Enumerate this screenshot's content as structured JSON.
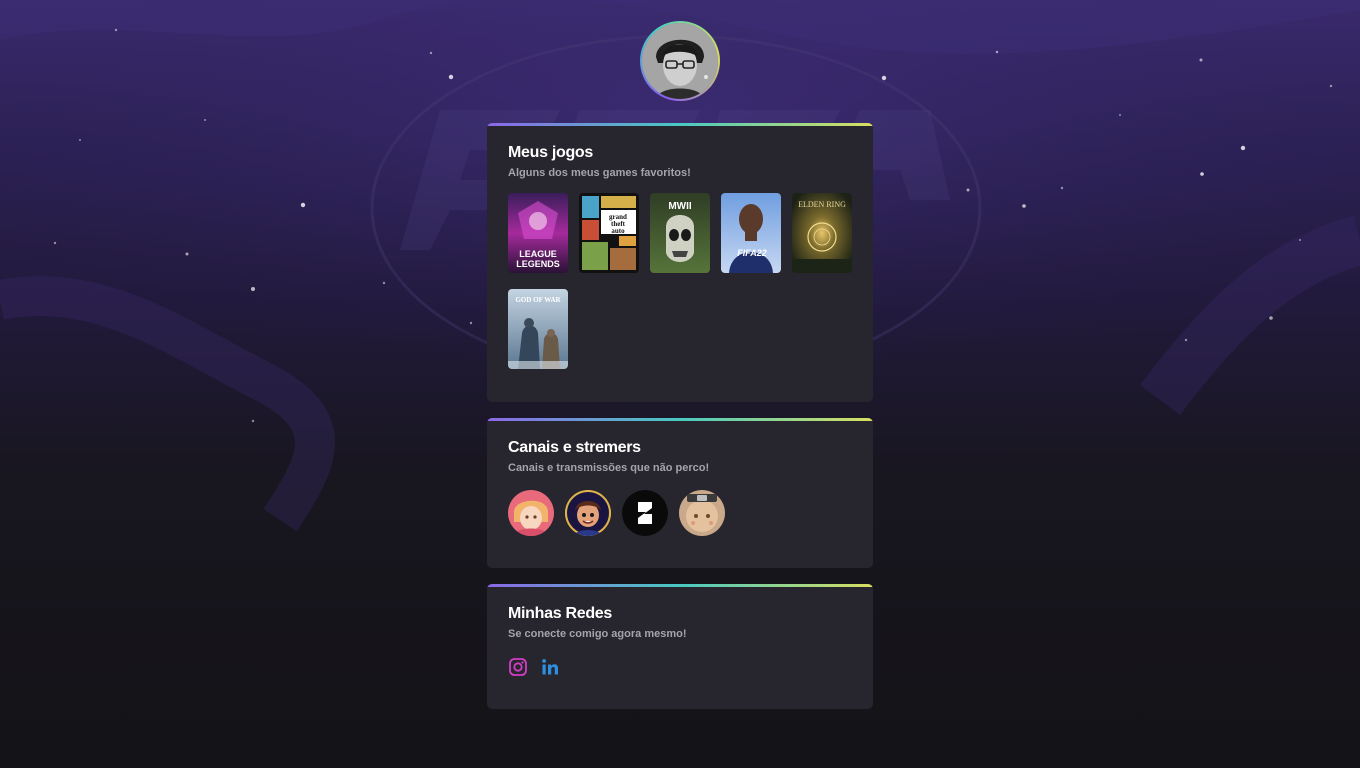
{
  "profile": {
    "avatar_icon": "user-avatar"
  },
  "colors": {
    "card_bg": "#27252e",
    "accent_gradient": [
      "#8b68e8",
      "#49c9c1",
      "#d8df61"
    ],
    "subtitle": "#a5a3ad",
    "instagram": "#d23ec5",
    "linkedin": "#2d8fe0"
  },
  "games_section": {
    "title": "Meus jogos",
    "subtitle": "Alguns dos meus games favoritos!",
    "games": [
      {
        "name": "League of Legends",
        "cover_text": "LEAGUE OF LEGENDS"
      },
      {
        "name": "Grand Theft Auto V",
        "cover_text": "grand theft auto"
      },
      {
        "name": "Call of Duty Modern Warfare II",
        "cover_text": "MWII"
      },
      {
        "name": "FIFA 22",
        "cover_text": "FIFA22"
      },
      {
        "name": "Elden Ring",
        "cover_text": "ELDEN RING"
      },
      {
        "name": "God of War Ragnarök",
        "cover_text": "GOD OF WAR"
      }
    ]
  },
  "streamers_section": {
    "title": "Canais e stremers",
    "subtitle": "Canais e transmissões que não perco!",
    "streamers": [
      {
        "icon": "streamer-avatar-1"
      },
      {
        "icon": "streamer-avatar-2"
      },
      {
        "icon": "streamer-avatar-3"
      },
      {
        "icon": "streamer-avatar-4"
      }
    ]
  },
  "socials_section": {
    "title": "Minhas Redes",
    "subtitle": "Se conecte comigo agora mesmo!",
    "links": [
      {
        "icon": "instagram-icon"
      },
      {
        "icon": "linkedin-icon"
      }
    ]
  }
}
